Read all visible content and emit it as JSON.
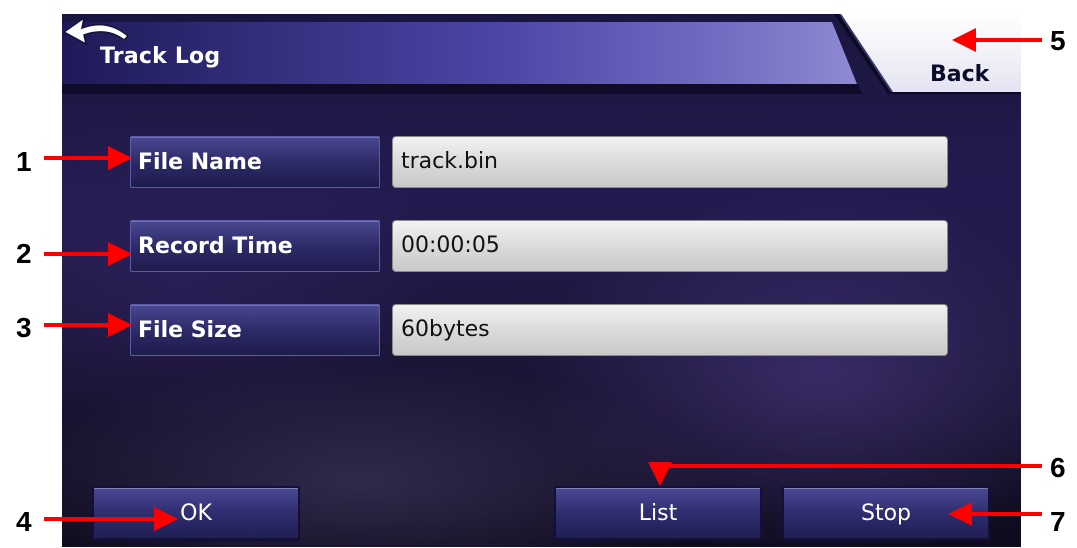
{
  "header": {
    "title": "Track Log",
    "back_label": "Back"
  },
  "fields": [
    {
      "label": "File Name",
      "value": "track.bin"
    },
    {
      "label": "Record Time",
      "value": "00:00:05"
    },
    {
      "label": "File Size",
      "value": "60bytes"
    }
  ],
  "buttons": {
    "ok_label": "OK",
    "list_label": "List",
    "stop_label": "Stop"
  },
  "callouts": [
    "1",
    "2",
    "3",
    "4",
    "5",
    "6",
    "7"
  ],
  "colors": {
    "callout_arrow": "#ff0000",
    "label_button": "#2d2b68",
    "value_box": "#d9d9d9"
  }
}
